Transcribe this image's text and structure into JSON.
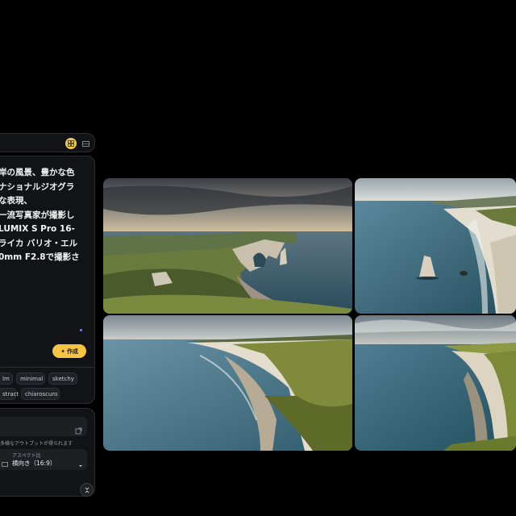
{
  "prompt": {
    "lines": [
      "岸の風景、豊かな色",
      "ナショナルジオグラ",
      "な表現、",
      "一流写真家が撮影し",
      "LUMIX S Pro 16-",
      "ライカ バリオ・エル",
      "0mm F2.8で撮影さ"
    ],
    "create_label": "作成"
  },
  "style_chips": [
    "lm",
    "minimal",
    "sketchy",
    "stract",
    "chiaroscuro"
  ],
  "settings": {
    "hint": "多様なアウトプットが得られます",
    "aspect_label": "アスペクト比",
    "aspect_value": "横向き（16:9）"
  },
  "colors": {
    "accent": "#f6c445",
    "panel": "#121316",
    "background": "#000000"
  },
  "icons": {
    "grid": "grid-view-icon",
    "single": "single-view-icon",
    "sparkle": "sparkle-icon",
    "open": "open-external-icon",
    "aspect": "aspect-ratio-icon",
    "dropdown": "chevron-down-icon",
    "collapse": "collapse-icon"
  }
}
